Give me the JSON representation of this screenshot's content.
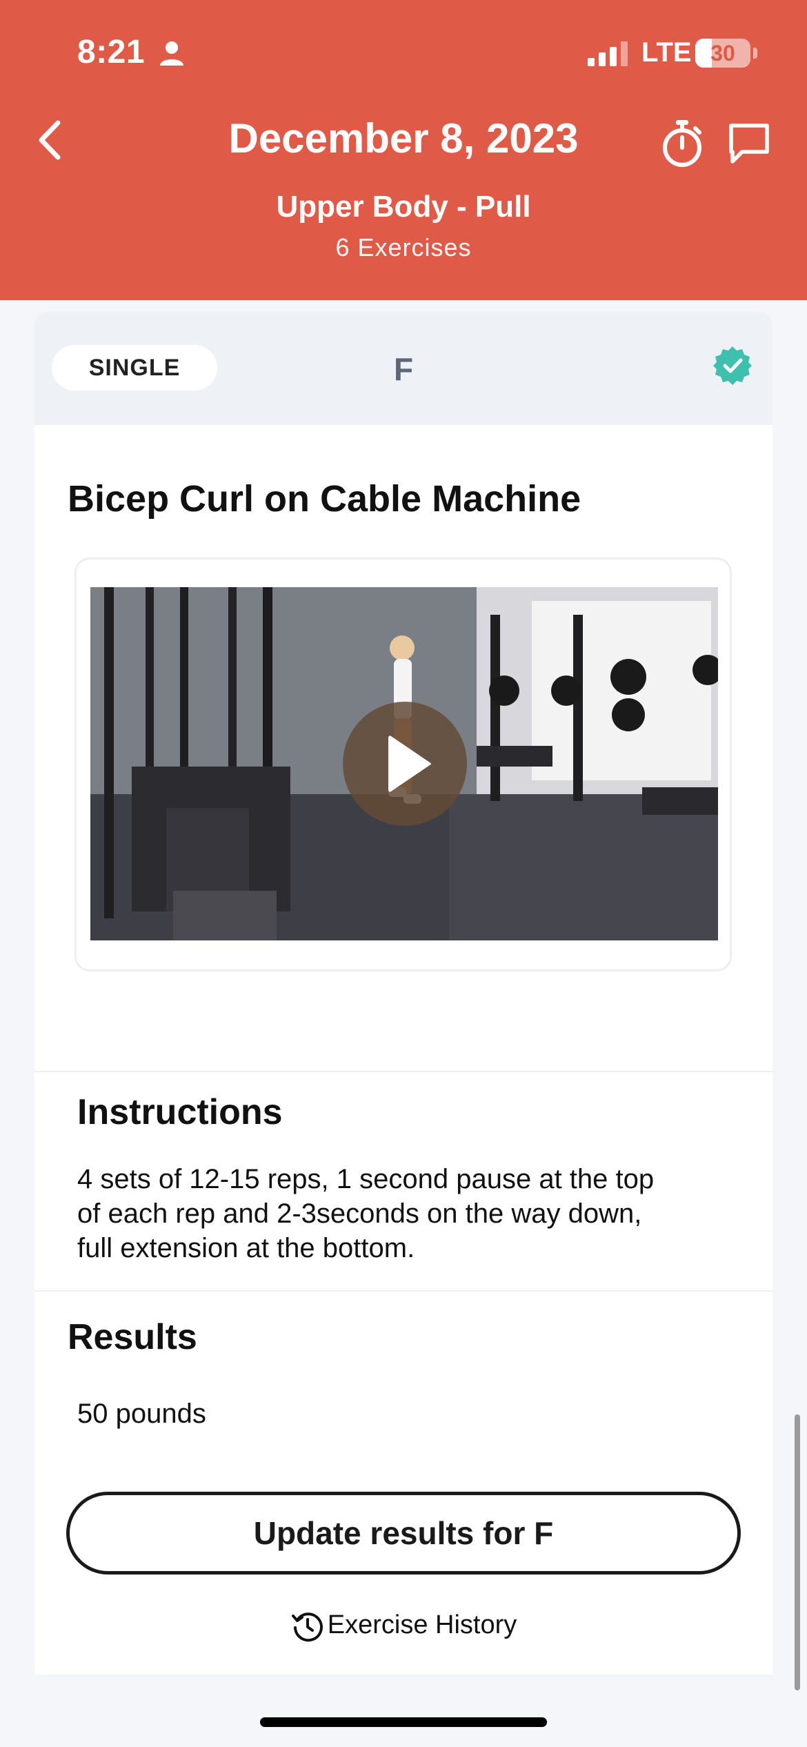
{
  "status_bar": {
    "time": "8:21",
    "network": "LTE",
    "battery": "30",
    "battery_level": 0.3
  },
  "header": {
    "title": "December 8, 2023",
    "workout_name": "Upper Body - Pull",
    "exercise_count": "6 Exercises",
    "background_color": "#e05a48"
  },
  "card": {
    "type_label": "SINGLE",
    "letter": "F",
    "completed": true,
    "check_color": "#3fbfad"
  },
  "exercise": {
    "title": "Bicep Curl on Cable Machine",
    "instructions_heading": "Instructions",
    "instructions_lines": [
      "4 sets of 12-15 reps, 1 second pause at the top",
      "of each rep and 2-3seconds on the way down,",
      "full extension at the bottom."
    ],
    "results_heading": "Results",
    "results_value": "50 pounds",
    "update_button": "Update results for F",
    "history_link": "Exercise History"
  },
  "icons": {
    "back": "chevron-left-icon",
    "timer": "stopwatch-icon",
    "chat": "chat-bubble-icon",
    "check": "verified-check-icon",
    "play": "play-icon",
    "history": "history-clock-icon"
  }
}
